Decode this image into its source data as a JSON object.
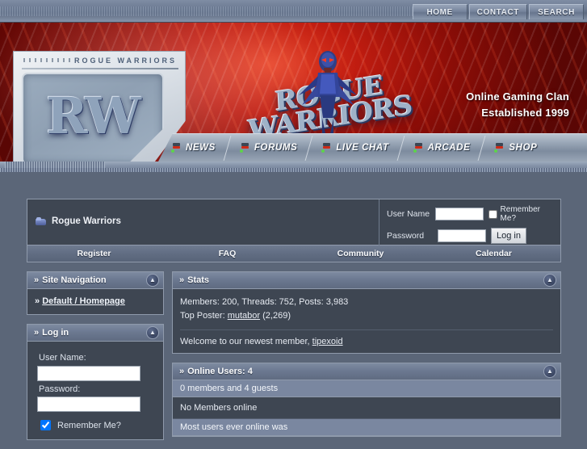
{
  "topnav": {
    "items": [
      {
        "label": "HOME",
        "name": "topnav-home"
      },
      {
        "label": "CONTACT",
        "name": "topnav-contact"
      },
      {
        "label": "SEARCH",
        "name": "topnav-search"
      }
    ]
  },
  "banner": {
    "plate_label": "ROGUE WARRIORS",
    "logo_mark": "RW",
    "wordmark": "ROGUE WARRIORS",
    "tagline_line1": "Online Gaming Clan",
    "tagline_line2": "Established 1999"
  },
  "mainnav": {
    "items": [
      {
        "label": "NEWS",
        "name": "mainnav-news"
      },
      {
        "label": "FORUMS",
        "name": "mainnav-forums"
      },
      {
        "label": "LIVE CHAT",
        "name": "mainnav-live-chat"
      },
      {
        "label": "ARCADE",
        "name": "mainnav-arcade"
      },
      {
        "label": "SHOP",
        "name": "mainnav-shop"
      }
    ]
  },
  "breadcrumb": {
    "label": "Rogue Warriors"
  },
  "header_login": {
    "username_label": "User Name",
    "username_value": "",
    "password_label": "Password",
    "password_value": "",
    "remember_label": "Remember Me?",
    "login_button": "Log in"
  },
  "subnav": {
    "items": [
      {
        "label": "Register",
        "name": "subnav-register"
      },
      {
        "label": "FAQ",
        "name": "subnav-faq"
      },
      {
        "label": "Community",
        "name": "subnav-community"
      },
      {
        "label": "Calendar",
        "name": "subnav-calendar"
      }
    ]
  },
  "site_navigation": {
    "title": "Site Navigation",
    "chevron": "»",
    "link_prefix": "» ",
    "link_label": "Default / Homepage"
  },
  "sidebar_login": {
    "title": "Log in",
    "chevron": "»",
    "username_label": "User Name:",
    "username_value": "",
    "password_label": "Password:",
    "password_value": "",
    "remember_label": "Remember Me?"
  },
  "stats": {
    "title": "Stats",
    "chevron": "»",
    "members_label": "Members:",
    "members_value": "200",
    "threads_label": "Threads:",
    "threads_value": "752",
    "posts_label": "Posts:",
    "posts_value": "3,983",
    "line1": "Members: 200, Threads: 752, Posts: 3,983",
    "top_poster_label": "Top Poster:",
    "top_poster_name": "mutabor",
    "top_poster_count": "(2,269)",
    "welcome_prefix": "Welcome to our newest member,",
    "newest_member": "tipexoid"
  },
  "online_users": {
    "title": "Online Users: 4",
    "chevron": "»",
    "count": "4",
    "summary": "0 members and 4 guests",
    "no_members": "No Members online",
    "record_line": "Most users ever online was"
  },
  "icons": {
    "collapse": "A",
    "collapse_glyph": "»"
  },
  "colors": {
    "page_bg": "#5b6678",
    "panel_bg": "#3e4652",
    "panel_head": "#6b7890",
    "banner_red": "#c01c10",
    "accent_steel": "#8f9aab",
    "highlight_bar": "#7a87a0"
  }
}
